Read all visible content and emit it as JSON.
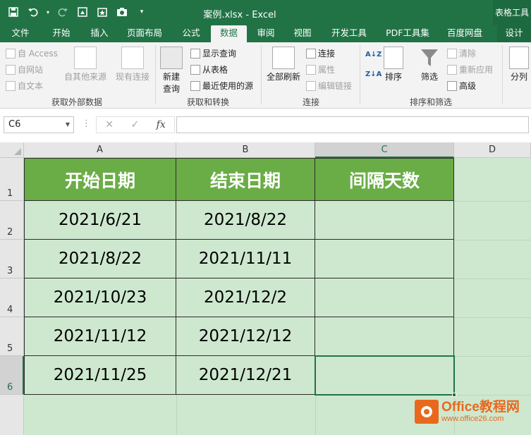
{
  "window": {
    "title": "案例.xlsx - Excel",
    "context_tab": "表格工具"
  },
  "tabs": [
    {
      "label": "文件"
    },
    {
      "label": "开始"
    },
    {
      "label": "插入"
    },
    {
      "label": "页面布局"
    },
    {
      "label": "公式"
    },
    {
      "label": "数据",
      "active": true
    },
    {
      "label": "审阅"
    },
    {
      "label": "视图"
    },
    {
      "label": "开发工具"
    },
    {
      "label": "PDF工具集"
    },
    {
      "label": "百度网盘"
    },
    {
      "label": "设计"
    }
  ],
  "ribbon": {
    "external": {
      "label": "获取外部数据",
      "access": "自 Access",
      "web": "自网站",
      "text": "自文本",
      "other": "自其他来源",
      "existing": "现有连接"
    },
    "transform": {
      "label": "获取和转换",
      "new_query_1": "新建",
      "new_query_2": "查询",
      "show_query": "显示查询",
      "from_table": "从表格",
      "recent": "最近使用的源"
    },
    "connections": {
      "label": "连接",
      "refresh_all": "全部刷新",
      "connections": "连接",
      "properties": "属性",
      "edit_links": "编辑链接"
    },
    "sort_filter": {
      "label": "排序和筛选",
      "sort_az": "A↓Z",
      "sort_za": "Z↓A",
      "sort": "排序",
      "filter": "筛选",
      "clear": "清除",
      "reapply": "重新应用",
      "advanced": "高级"
    },
    "tools": {
      "split": "分列"
    }
  },
  "formula_bar": {
    "name_box": "C6",
    "cancel": "✕",
    "confirm": "✓",
    "fx": "fx",
    "value": ""
  },
  "sheet": {
    "columns": [
      "A",
      "B",
      "C",
      "D"
    ],
    "rows": [
      "1",
      "2",
      "3",
      "4",
      "5",
      "6"
    ],
    "selected_cell": "C6",
    "headers": [
      "开始日期",
      "结束日期",
      "间隔天数"
    ],
    "data": [
      [
        "2021/6/21",
        "2021/8/22",
        ""
      ],
      [
        "2021/8/22",
        "2021/11/11",
        ""
      ],
      [
        "2021/10/23",
        "2021/12/2",
        ""
      ],
      [
        "2021/11/12",
        "2021/12/12",
        ""
      ],
      [
        "2021/11/25",
        "2021/12/21",
        ""
      ]
    ],
    "header_fill": "#6aad46",
    "body_fill": "#cee8cf"
  },
  "watermark": {
    "line1": "Office教程网",
    "line2": "www.office26.com"
  },
  "colors": {
    "brand": "#217346",
    "watermark": "#e8691e"
  }
}
